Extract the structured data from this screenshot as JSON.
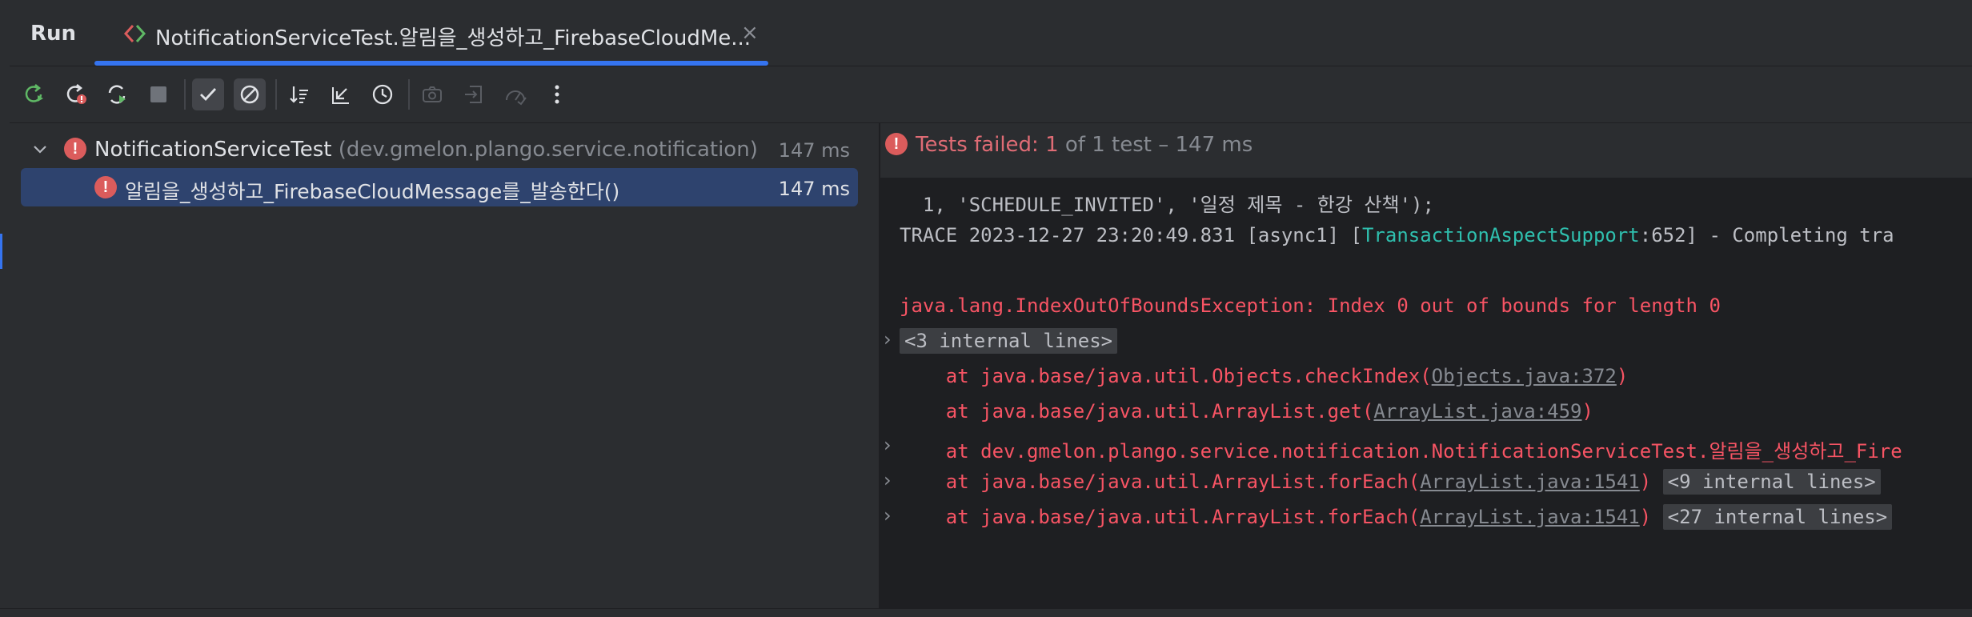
{
  "header": {
    "run_label": "Run",
    "tab_title": "NotificationServiceTest.알림을_생성하고_FirebaseCloudMe...",
    "tab_close": "×"
  },
  "toolbar": {
    "buttons": [
      {
        "name": "rerun-icon",
        "on": false
      },
      {
        "name": "rerun-failed-icon",
        "on": false
      },
      {
        "name": "toggle-auto-test-icon",
        "on": false
      },
      {
        "name": "stop-icon",
        "on": false
      },
      {
        "name": "show-passed-icon",
        "on": true
      },
      {
        "name": "show-ignored-icon",
        "on": true
      },
      {
        "name": "sort-icon",
        "on": false
      },
      {
        "name": "collapse-icon",
        "on": false
      },
      {
        "name": "history-icon",
        "on": false
      },
      {
        "name": "screenshot-icon",
        "on": false
      },
      {
        "name": "import-icon",
        "on": false
      },
      {
        "name": "coverage-icon",
        "on": false
      },
      {
        "name": "more-options-icon",
        "on": false
      }
    ]
  },
  "tree": {
    "root": {
      "name": "NotificationServiceTest",
      "package": "(dev.gmelon.plango.service.notification)",
      "time": "147 ms"
    },
    "child": {
      "name": "알림을_생성하고_FirebaseCloudMessage를_발송한다()",
      "time": "147 ms"
    }
  },
  "status": {
    "failed": "Tests failed: 1",
    "rest": " of 1 test – 147 ms"
  },
  "console": {
    "l1": "  1, 'SCHEDULE_INVITED', '일정 제목 - 한강 산책');",
    "l2_a": "TRACE 2023-12-27 23:20:49.831 [async1] [",
    "l2_b": "TransactionAspectSupport",
    "l2_c": ":652] - Completing tra",
    "l3": "java.lang.IndexOutOfBoundsException: Index 0 out of bounds for length 0",
    "l4": "<3 internal lines>",
    "l5_a": "    at java.base/java.util.Objects.checkIndex(",
    "l5_link": "Objects.java:372",
    "l5_b": ")",
    "l6_a": "    at java.base/java.util.ArrayList.get(",
    "l6_link": "ArrayList.java:459",
    "l6_b": ")",
    "l7": "    at dev.gmelon.plango.service.notification.NotificationServiceTest.알림을_생성하고_Fire",
    "l8_a": "    at java.base/java.util.ArrayList.forEach(",
    "l8_link": "ArrayList.java:1541",
    "l8_b": ")",
    "l8_fold": "<9 internal lines>",
    "l9_a": "    at java.base/java.util.ArrayList.forEach(",
    "l9_link": "ArrayList.java:1541",
    "l9_b": ")",
    "l9_fold": "<27 internal lines>",
    "chev": "›"
  },
  "colors": {
    "accent": "#3574f0",
    "error": "#f75464",
    "selection": "#2e436e",
    "cyan": "#2fbfae"
  }
}
